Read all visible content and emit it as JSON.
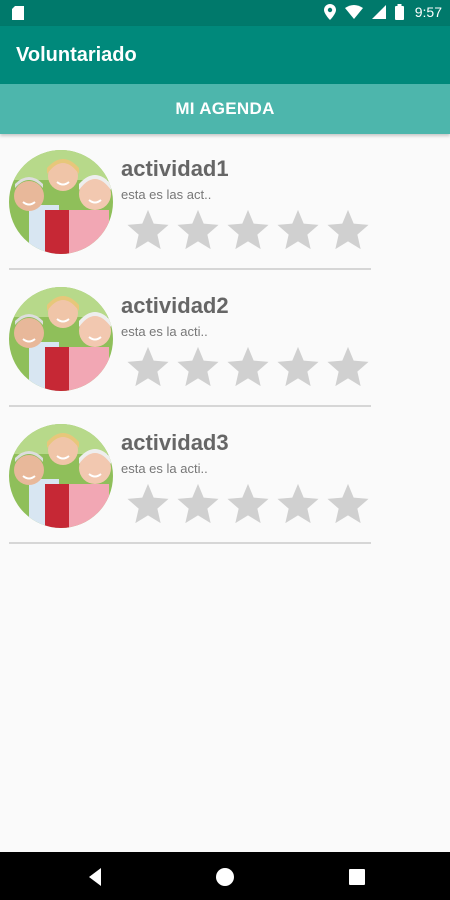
{
  "status_bar": {
    "time": "9:57",
    "icons": [
      "sim-card-icon",
      "location-icon",
      "wifi-icon",
      "cell-signal-icon",
      "battery-icon"
    ]
  },
  "app_bar": {
    "title": "Voluntariado"
  },
  "tabs": [
    {
      "label": "MI AGENDA"
    }
  ],
  "activities": [
    {
      "title": "actividad1",
      "description": "esta es las act..",
      "rating": 0,
      "max_rating": 5
    },
    {
      "title": "actividad2",
      "description": "esta es la acti..",
      "rating": 0,
      "max_rating": 5
    },
    {
      "title": "actividad3",
      "description": "esta es la acti..",
      "rating": 0,
      "max_rating": 5
    }
  ],
  "nav_bar": {
    "buttons": [
      "back-icon",
      "home-icon",
      "recents-icon"
    ]
  },
  "colors": {
    "status_bar": "#00796b",
    "app_bar": "#00897b",
    "tab_bar": "#4db6ac",
    "star_empty": "#d0d0d0",
    "background": "#fafafa"
  }
}
